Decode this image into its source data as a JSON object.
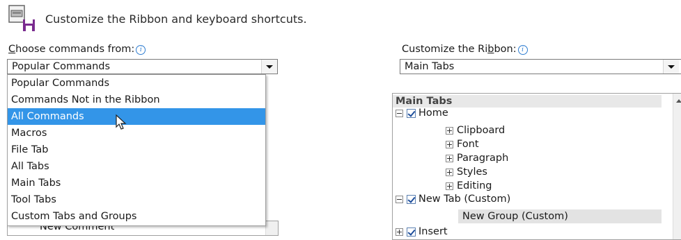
{
  "header": {
    "title": "Customize the Ribbon and keyboard shortcuts.",
    "icon": "customize-ribbon-icon"
  },
  "left": {
    "label_pre": "",
    "label_accel": "C",
    "label_post": "hoose commands from:",
    "info_glyph": "i",
    "selected": "Popular Commands",
    "options": [
      "Popular Commands",
      "Commands Not in the Ribbon",
      "All Commands",
      "Macros",
      "File Tab",
      "All Tabs",
      "Main Tabs",
      "Tool Tabs",
      "Custom Tabs and Groups"
    ],
    "highlighted_index": 2,
    "partial_item": "New Comment"
  },
  "right": {
    "label_pre": "Customize the Ri",
    "label_accel": "b",
    "label_post": "bon:",
    "info_glyph": "i",
    "selected": "Main Tabs",
    "tree_header": "Main Tabs",
    "tree": [
      {
        "label": "Home",
        "expander": "minus",
        "checked": true
      },
      {
        "label": "Clipboard",
        "expander": "plus"
      },
      {
        "label": "Font",
        "expander": "plus"
      },
      {
        "label": "Paragraph",
        "expander": "plus"
      },
      {
        "label": "Styles",
        "expander": "plus"
      },
      {
        "label": "Editing",
        "expander": "plus"
      },
      {
        "label": "New Tab (Custom)",
        "expander": "minus",
        "checked": true
      },
      {
        "label": "New Group (Custom)"
      },
      {
        "label": "Insert",
        "expander": "plus",
        "checked": true
      }
    ]
  },
  "colors": {
    "selection": "#3395e8",
    "info": "#2e7dd1"
  }
}
